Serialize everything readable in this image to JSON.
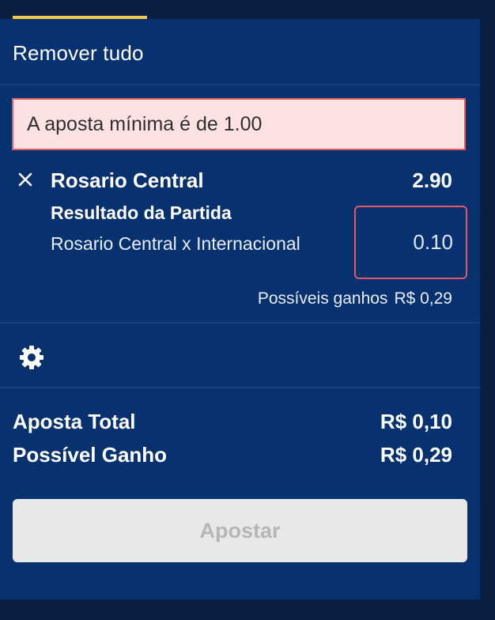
{
  "header": {
    "remove_all_label": "Remover tudo"
  },
  "alert": {
    "message": "A aposta mínima é de 1.00"
  },
  "selection": {
    "team": "Rosario Central",
    "odds": "2.90",
    "market": "Resultado da Partida",
    "match": "Rosario Central x Internacional",
    "stake_value": "0.10",
    "possible_wins_label": "Possíveis ganhos",
    "possible_wins_value": "R$ 0,29"
  },
  "summary": {
    "total_label": "Aposta Total",
    "total_value": "R$ 0,10",
    "gain_label": "Possível Ganho",
    "gain_value": "R$ 0,29"
  },
  "actions": {
    "bet_label": "Apostar"
  },
  "icons": {
    "close": "close-icon",
    "settings": "gear-icon"
  },
  "colors": {
    "panel": "#08316f",
    "error_bg": "#fde2e2",
    "error_border": "#e05a64",
    "tab_indicator": "#f2c94c",
    "button_disabled": "#e8e8e8"
  }
}
